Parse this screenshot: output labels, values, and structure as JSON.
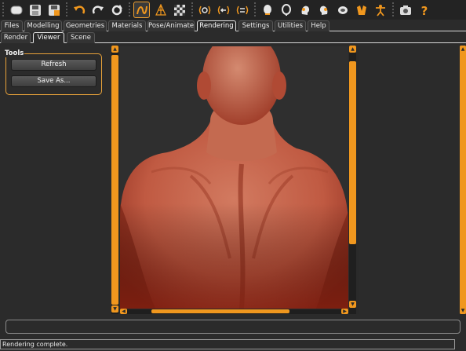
{
  "toolbar": {
    "icons": [
      "undo-icon",
      "redo-icon",
      "reset-icon"
    ]
  },
  "main_tabs": [
    {
      "label": "Files"
    },
    {
      "label": "Modelling"
    },
    {
      "label": "Geometries"
    },
    {
      "label": "Materials"
    },
    {
      "label": "Pose/Animate"
    },
    {
      "label": "Rendering",
      "active": true
    },
    {
      "label": "Settings"
    },
    {
      "label": "Utilities"
    },
    {
      "label": "Help"
    }
  ],
  "sub_tabs": [
    {
      "label": "Render"
    },
    {
      "label": "Viewer",
      "active": true
    },
    {
      "label": "Scene"
    }
  ],
  "tools": {
    "title": "Tools",
    "refresh_label": "Refresh",
    "save_as_label": "Save As..."
  },
  "status": {
    "message": "Rendering complete."
  },
  "colors": {
    "accent": "#f0971e",
    "background": "#2b2b2b",
    "skin": "#c9654c"
  }
}
